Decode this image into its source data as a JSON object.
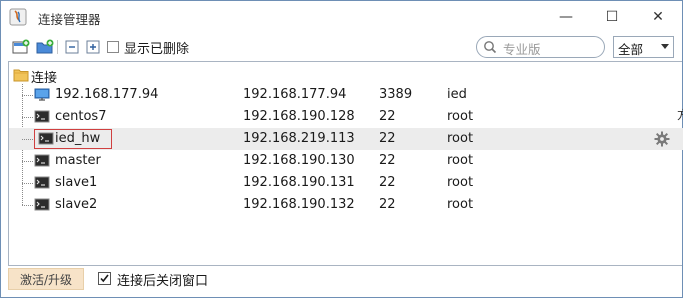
{
  "window": {
    "title": "连接管理器",
    "minimize_glyph": "—",
    "maximize_glyph": "☐",
    "close_glyph": "✕"
  },
  "toolbar": {
    "icons": [
      "new-connection-icon",
      "new-folder-icon",
      "collapse-all-icon",
      "expand-all-icon"
    ],
    "show_deleted_label": "显示已删除",
    "show_deleted_checked": false,
    "search_placeholder": "专业版",
    "filter_selected": "全部"
  },
  "tree": {
    "root_label": "连接",
    "rows": [
      {
        "name": "192.168.177.94",
        "ip": "192.168.177.94",
        "port": "3389",
        "user": "ied",
        "icon": "remote-desktop-icon"
      },
      {
        "name": "centos7",
        "ip": "192.168.190.128",
        "port": "22",
        "user": "root",
        "icon": "terminal-icon"
      },
      {
        "name": "ied_hw",
        "ip": "192.168.219.113",
        "port": "22",
        "user": "root",
        "icon": "terminal-icon"
      },
      {
        "name": "master",
        "ip": "192.168.190.130",
        "port": "22",
        "user": "root",
        "icon": "terminal-icon"
      },
      {
        "name": "slave1",
        "ip": "192.168.190.131",
        "port": "22",
        "user": "root",
        "icon": "terminal-icon"
      },
      {
        "name": "slave2",
        "ip": "192.168.190.132",
        "port": "22",
        "user": "root",
        "icon": "terminal-icon"
      }
    ],
    "highlighted_index": 2,
    "side_char": "方"
  },
  "status": {
    "activate_label": "激活/升级",
    "close_after_label": "连接后关闭窗口",
    "close_after_checked": true
  },
  "colors": {
    "accent": "#2f7bd6",
    "highlight_row": "#ececec",
    "edit_border": "#d04040",
    "activate_bg": "#f7e3c8"
  }
}
